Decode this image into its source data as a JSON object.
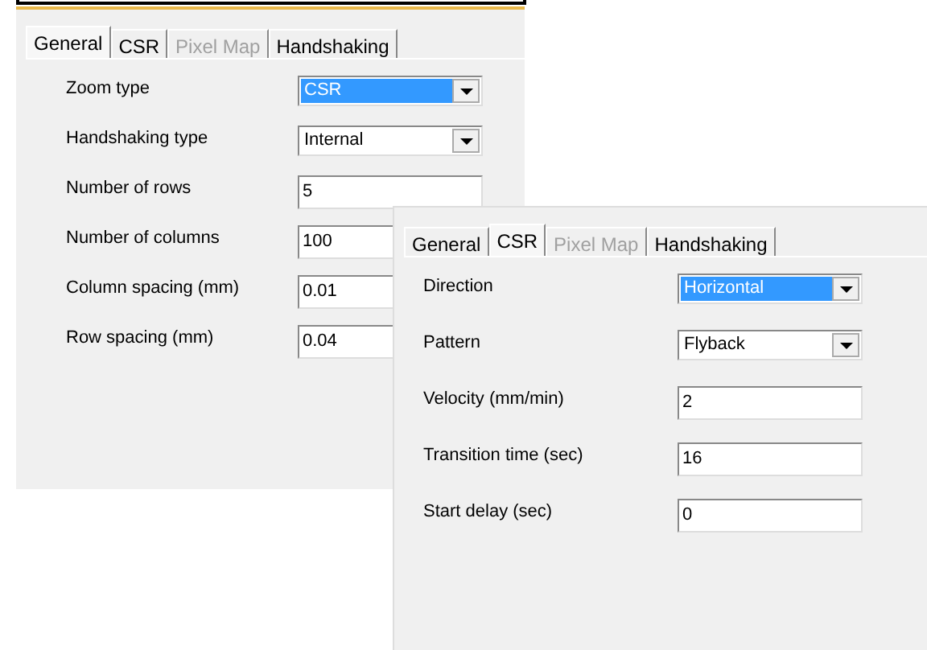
{
  "dialogs": [
    {
      "tabs": [
        {
          "label": "General",
          "selected": true,
          "disabled": false
        },
        {
          "label": "CSR",
          "selected": false,
          "disabled": false
        },
        {
          "label": "Pixel Map",
          "selected": false,
          "disabled": true
        },
        {
          "label": "Handshaking",
          "selected": false,
          "disabled": false
        }
      ],
      "fields": [
        {
          "label": "Zoom type",
          "kind": "dropdown",
          "value": "CSR",
          "highlighted": true
        },
        {
          "label": "Handshaking type",
          "kind": "dropdown",
          "value": "Internal",
          "highlighted": false
        },
        {
          "label": "Number of rows",
          "kind": "text",
          "value": "5"
        },
        {
          "label": "Number of columns",
          "kind": "text",
          "value": "100"
        },
        {
          "label": "Column spacing (mm)",
          "kind": "text",
          "value": "0.01"
        },
        {
          "label": "Row spacing (mm)",
          "kind": "text",
          "value": "0.04"
        }
      ]
    },
    {
      "tabs": [
        {
          "label": "General",
          "selected": false,
          "disabled": false
        },
        {
          "label": "CSR",
          "selected": true,
          "disabled": false
        },
        {
          "label": "Pixel Map",
          "selected": false,
          "disabled": true
        },
        {
          "label": "Handshaking",
          "selected": false,
          "disabled": false
        }
      ],
      "fields": [
        {
          "label": "Direction",
          "kind": "dropdown",
          "value": "Horizontal",
          "highlighted": true
        },
        {
          "label": "Pattern",
          "kind": "dropdown",
          "value": "Flyback",
          "highlighted": false
        },
        {
          "label": "Velocity (mm/min)",
          "kind": "text",
          "value": "2"
        },
        {
          "label": "Transition time (sec)",
          "kind": "text",
          "value": "16"
        },
        {
          "label": "Start delay (sec)",
          "kind": "text",
          "value": "0"
        }
      ]
    }
  ]
}
